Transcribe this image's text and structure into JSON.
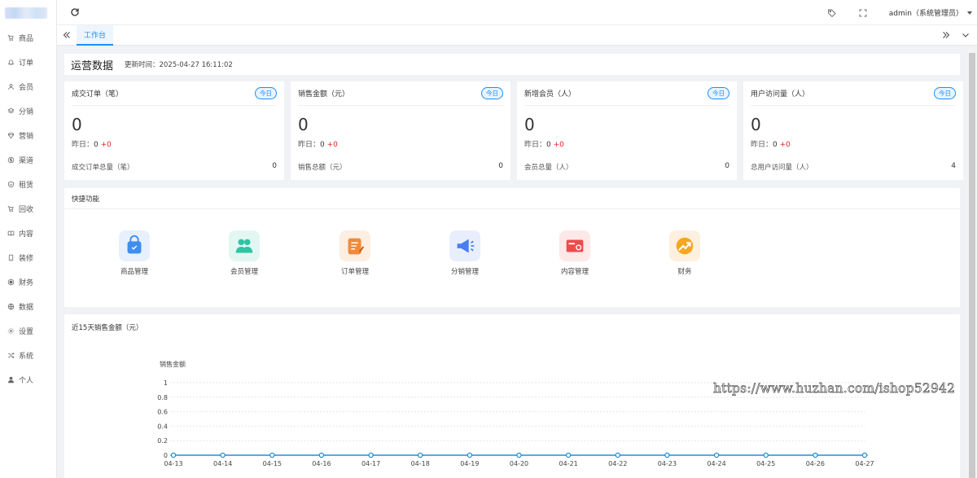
{
  "sidebar": {
    "items": [
      {
        "label": "商品",
        "icon": "cart-icon"
      },
      {
        "label": "订单",
        "icon": "bell-icon"
      },
      {
        "label": "会员",
        "icon": "user-icon"
      },
      {
        "label": "分销",
        "icon": "layers-icon"
      },
      {
        "label": "营销",
        "icon": "diamond-icon"
      },
      {
        "label": "渠道",
        "icon": "dollar-circle-icon"
      },
      {
        "label": "租赁",
        "icon": "shield-icon"
      },
      {
        "label": "回收",
        "icon": "cart-icon"
      },
      {
        "label": "内容",
        "icon": "book-icon"
      },
      {
        "label": "装修",
        "icon": "mobile-icon"
      },
      {
        "label": "财务",
        "icon": "finance-icon"
      },
      {
        "label": "数据",
        "icon": "globe-icon"
      },
      {
        "label": "设置",
        "icon": "gear-icon"
      },
      {
        "label": "系统",
        "icon": "shuffle-icon"
      },
      {
        "label": "个人",
        "icon": "person-icon"
      }
    ]
  },
  "topbar": {
    "user": "admin（系统管理员）"
  },
  "tabs": [
    {
      "label": "工作台",
      "active": true
    }
  ],
  "ops": {
    "title": "运营数据",
    "updated": "更新时间：2025-04-27 16:11:02"
  },
  "stats": [
    {
      "label": "成交订单（笔）",
      "tag": "今日",
      "value": "0",
      "yesterday_label": "昨日：",
      "yesterday": "0",
      "delta": "+0",
      "total_label": "成交订单总量（笔）",
      "total": "0"
    },
    {
      "label": "销售金额（元）",
      "tag": "今日",
      "value": "0",
      "yesterday_label": "昨日：",
      "yesterday": "0",
      "delta": "+0",
      "total_label": "销售总额（元）",
      "total": "0"
    },
    {
      "label": "新增会员（人）",
      "tag": "今日",
      "value": "0",
      "yesterday_label": "昨日：",
      "yesterday": "0",
      "delta": "+0",
      "total_label": "会员总量（人）",
      "total": "0"
    },
    {
      "label": "用户访问量（人）",
      "tag": "今日",
      "value": "0",
      "yesterday_label": "昨日：",
      "yesterday": "0",
      "delta": "+0",
      "total_label": "总用户访问量（人）",
      "total": "4"
    }
  ],
  "quick": {
    "title": "快捷功能",
    "items": [
      {
        "label": "商品管理",
        "icon": "shopping-bag-icon",
        "color": "#3d8ef0",
        "bg": "#e7f0fc"
      },
      {
        "label": "会员管理",
        "icon": "members-icon",
        "color": "#2ec4a6",
        "bg": "#e3f7f2"
      },
      {
        "label": "订单管理",
        "icon": "order-edit-icon",
        "color": "#f08a3a",
        "bg": "#fdeee2"
      },
      {
        "label": "分销管理",
        "icon": "megaphone-icon",
        "color": "#4a7ef0",
        "bg": "#e8eefc"
      },
      {
        "label": "内容管理",
        "icon": "content-card-icon",
        "color": "#ee4b4b",
        "bg": "#fde8e8"
      },
      {
        "label": "财务",
        "icon": "trend-up-icon",
        "color": "#f5a623",
        "bg": "#fdf0de"
      }
    ]
  },
  "chart_title": "近15天销售金额（元）",
  "chart_data": {
    "type": "line",
    "title": "",
    "ylabel": "销售金额",
    "xlabel": "",
    "x": [
      "04-13",
      "04-14",
      "04-15",
      "04-16",
      "04-17",
      "04-18",
      "04-19",
      "04-20",
      "04-21",
      "04-22",
      "04-23",
      "04-24",
      "04-25",
      "04-26",
      "04-27"
    ],
    "series": [
      {
        "name": "",
        "values": [
          0,
          0,
          0,
          0,
          0,
          0,
          0,
          0,
          0,
          0,
          0,
          0,
          0,
          0,
          0
        ]
      }
    ],
    "ylim": [
      0,
      1
    ],
    "yticks": [
      "0",
      "0.2",
      "0.4",
      "0.6",
      "0.8",
      "1"
    ],
    "line_color": "#1f8fd6",
    "grid": true
  },
  "watermark": "https://www.huzhan.com/ishop52942"
}
